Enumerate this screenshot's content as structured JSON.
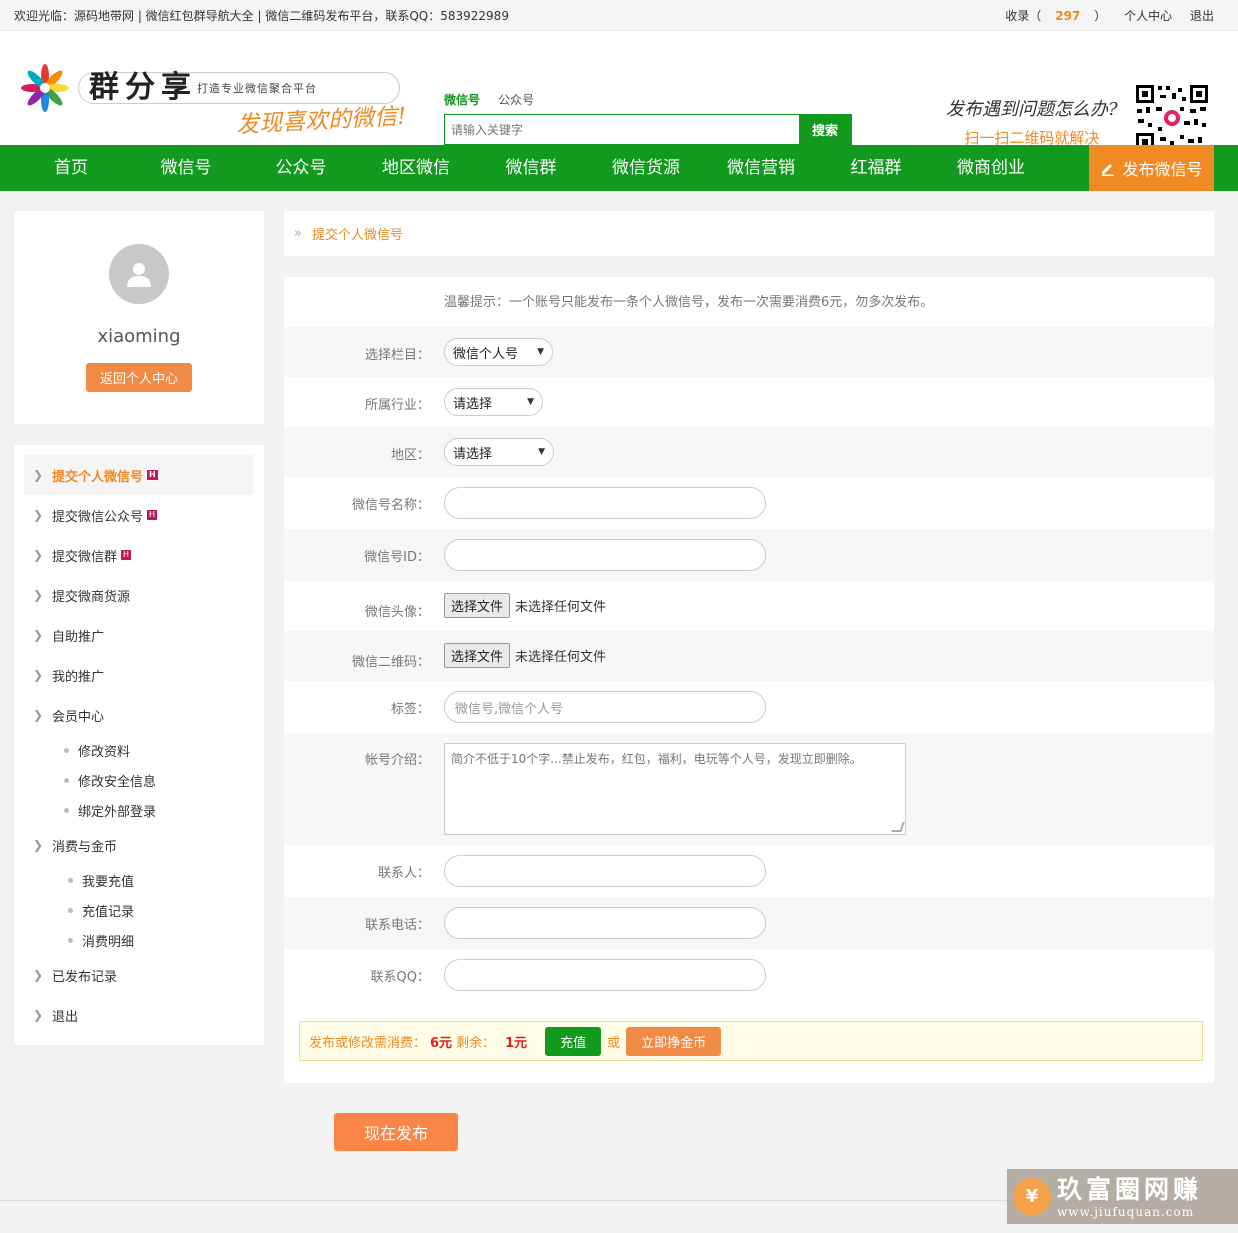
{
  "topbar": {
    "welcome": "欢迎光临：源码地带网 | 微信红包群导航大全 | 微信二维码发布平台，联系QQ：583922989",
    "collect_prefix": "收录（",
    "collect_count": "297",
    "collect_suffix": "）",
    "user_center": "个人中心",
    "logout": "退出"
  },
  "header": {
    "logo_name": "群分享",
    "logo_sub": "打造专业微信聚合平台",
    "slogan": "发现喜欢的微信!",
    "search_tab_1": "微信号",
    "search_tab_2": "公众号",
    "search_placeholder": "请输入关键字",
    "search_button": "搜索",
    "help_question": "发布遇到问题怎么办?",
    "help_answer": "扫一扫二维码就解决"
  },
  "nav": {
    "items": [
      "首页",
      "微信号",
      "公众号",
      "地区微信",
      "微信群",
      "微信货源",
      "微信营销",
      "红福群",
      "微商创业"
    ],
    "publish": "发布微信号"
  },
  "profile": {
    "username": "xiaoming",
    "back_button": "返回个人中心"
  },
  "menu": {
    "submit_personal": "提交个人微信号",
    "submit_official": "提交微信公众号",
    "submit_group": "提交微信群",
    "submit_goods": "提交微商货源",
    "self_promote": "自助推广",
    "my_promote": "我的推广",
    "member_center": "会员中心",
    "edit_profile": "修改资料",
    "edit_security": "修改安全信息",
    "bind_external": "绑定外部登录",
    "consume_coins": "消费与金币",
    "recharge": "我要充值",
    "recharge_log": "充值记录",
    "consume_detail": "消费明细",
    "published_log": "已发布记录",
    "logout": "退出",
    "hot_badge": "H"
  },
  "breadcrumb": {
    "current": "提交个人微信号"
  },
  "form": {
    "tip": "温馨提示：一个账号只能发布一条个人微信号，发布一次需要消费6元，勿多次发布。",
    "category_label": "选择栏目：",
    "category_value": "微信个人号",
    "industry_label": "所属行业：",
    "industry_value": "请选择",
    "region_label": "地区：",
    "region_value": "请选择",
    "name_label": "微信号名称：",
    "id_label": "微信号ID：",
    "avatar_label": "微信头像：",
    "qrcode_label": "微信二维码：",
    "file_button": "选择文件",
    "file_none": "未选择任何文件",
    "tags_label": "标签：",
    "tags_placeholder": "微信号,微信个人号",
    "intro_label": "帐号介绍：",
    "intro_placeholder": "简介不低于10个字...禁止发布，红包，福利，电玩等个人号，发现立即删除。",
    "contact_label": "联系人：",
    "phone_label": "联系电话：",
    "qq_label": "联系QQ："
  },
  "cost": {
    "prefix": "发布或修改需消费：",
    "price": "6元",
    "remain_label": "剩余：",
    "remain": "1元",
    "recharge_button": "充值",
    "or": "或",
    "earn_button": "立即挣金币"
  },
  "submit_button": "现在发布",
  "watermark": {
    "text": "玖富圈网赚",
    "url": "www.jiufuquan.com",
    "coin": "¥"
  },
  "colors": {
    "brand_green": "#129a1e",
    "accent_orange": "#f08a24",
    "price_red": "#e0201c"
  }
}
